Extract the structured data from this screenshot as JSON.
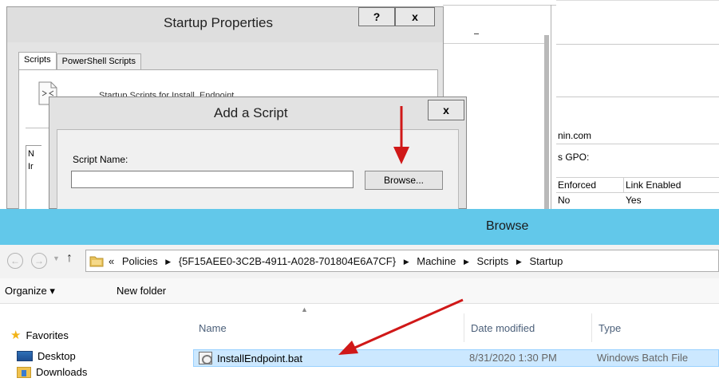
{
  "background_window": {
    "domain_text": "nin.com",
    "gpo_label": "s GPO:",
    "table_headers": [
      "Enforced",
      "Link Enabled"
    ],
    "table_row": [
      "No",
      "Yes"
    ]
  },
  "startup_properties": {
    "title": "Startup Properties",
    "help_label": "?",
    "close_label": "x",
    "tabs": [
      {
        "label": "Scripts",
        "active": true
      },
      {
        "label": "PowerShell Scripts",
        "active": false
      }
    ],
    "description": "Startup Scripts for Install_Endpoint",
    "list_partial_n": "N",
    "list_partial_i": "Ir"
  },
  "add_script": {
    "title": "Add a Script",
    "close_label": "x",
    "script_name_label": "Script Name:",
    "script_name_value": "",
    "browse_label": "Browse..."
  },
  "browse": {
    "title": "Browse",
    "title_bar_color": "#62c8ea",
    "nav": {
      "back_icon": "←",
      "forward_icon": "→",
      "recent_icon": "▼",
      "up_icon": "↑"
    },
    "breadcrumb": {
      "overflow": "«",
      "items": [
        "Policies",
        "{5F15AEE0-3C2B-4911-A028-701804E6A7CF}",
        "Machine",
        "Scripts",
        "Startup"
      ],
      "separator": "▶"
    },
    "toolbar": {
      "organize_label": "Organize ▾",
      "new_folder_label": "New folder"
    },
    "nav_pane": {
      "favorites": "Favorites",
      "desktop": "Desktop",
      "downloads": "Downloads"
    },
    "columns": {
      "name": "Name",
      "date_modified": "Date modified",
      "type": "Type"
    },
    "files": [
      {
        "name": "InstallEndpoint.bat",
        "date_modified": "8/31/2020 1:30 PM",
        "type": "Windows Batch File",
        "selected": true
      }
    ]
  },
  "annotations": {
    "arrow_color": "#d01818"
  }
}
